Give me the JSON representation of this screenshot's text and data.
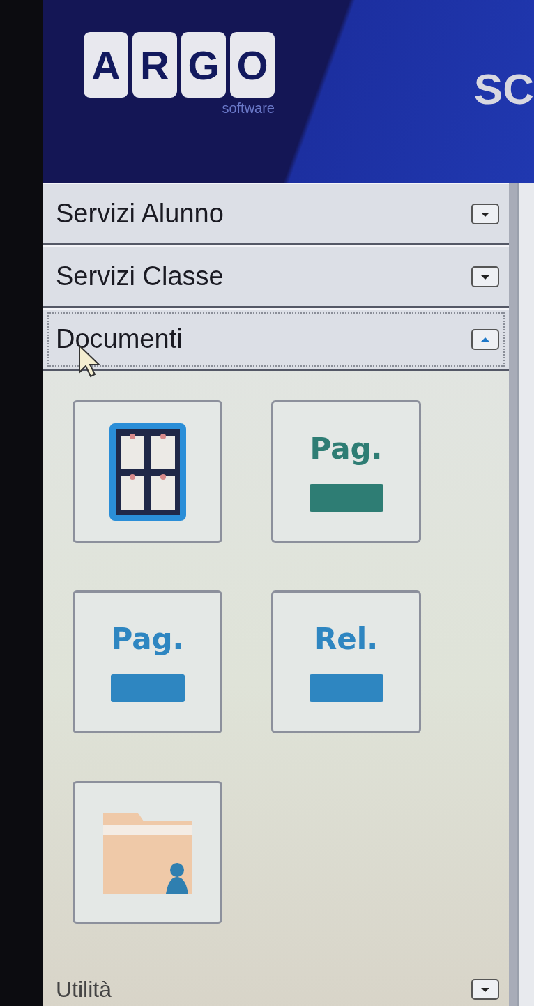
{
  "header": {
    "logo_letters": [
      "A",
      "R",
      "G",
      "O"
    ],
    "logo_subtitle": "software",
    "title": "SC"
  },
  "sections": [
    {
      "label": "Servizi Alunno",
      "expanded": false
    },
    {
      "label": "Servizi Classe",
      "expanded": false
    },
    {
      "label": "Documenti",
      "expanded": true,
      "tiles": [
        {
          "kind": "board"
        },
        {
          "kind": "badge",
          "text": "Pag.",
          "color": "#2e7d74"
        },
        {
          "kind": "badge",
          "text": "Pag.",
          "color": "#2e86c1"
        },
        {
          "kind": "badge",
          "text": "Rel.",
          "color": "#2e86c1"
        },
        {
          "kind": "folder"
        }
      ]
    },
    {
      "label": "Utilità",
      "expanded": false
    }
  ]
}
